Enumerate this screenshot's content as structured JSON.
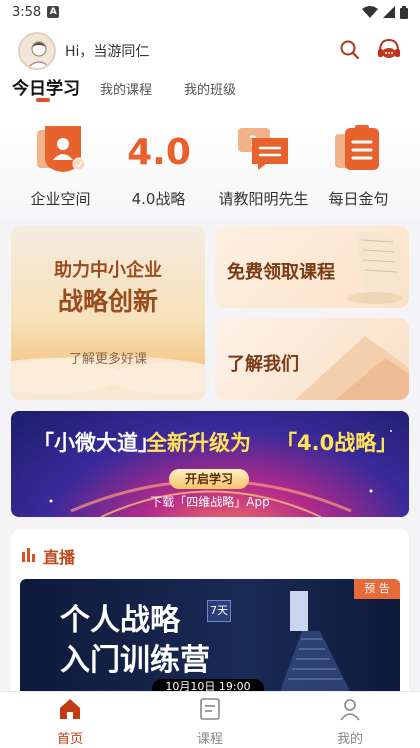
{
  "status_bar": {
    "time": "3:58",
    "badge": "A"
  },
  "header": {
    "greeting": "Hi，当游同仁",
    "tabs": [
      {
        "label": "今日学习",
        "active": true
      },
      {
        "label": "我的课程",
        "active": false
      },
      {
        "label": "我的班级",
        "active": false
      }
    ]
  },
  "quick_entries": [
    {
      "label": "企业空间",
      "icon": "enterprise-space-icon"
    },
    {
      "label": "4.0战略",
      "icon": "strategy-4-icon",
      "icon_text": "4.0"
    },
    {
      "label": "请教阳明先生",
      "icon": "ask-chat-icon"
    },
    {
      "label": "每日金句",
      "icon": "daily-quote-icon"
    }
  ],
  "cards": {
    "left": {
      "line1": "助力中小企业",
      "line2": "战略创新",
      "link": "了解更多好课"
    },
    "right_top": {
      "title": "免费领取课程"
    },
    "right_bottom": {
      "title": "了解我们"
    }
  },
  "banner": {
    "part1": "「小微大道」",
    "part2": "全新升级为",
    "part3": "「4.0战略」",
    "button": "开启学习",
    "caption": "下载「四维战略」App"
  },
  "live": {
    "title": "直播",
    "card": {
      "line1": "个人战略",
      "line2": "入门训练营",
      "days_badge": "7天",
      "tag": "预 告",
      "date": "10月10日 19:00"
    }
  },
  "bottom_nav": [
    {
      "label": "首页",
      "icon": "home-icon",
      "active": true
    },
    {
      "label": "课程",
      "icon": "course-icon",
      "active": false
    },
    {
      "label": "我的",
      "icon": "profile-icon",
      "active": false
    }
  ],
  "colors": {
    "accent": "#e04f2a",
    "brand_dark": "#c33a12",
    "card_text": "#9a4c1e"
  }
}
